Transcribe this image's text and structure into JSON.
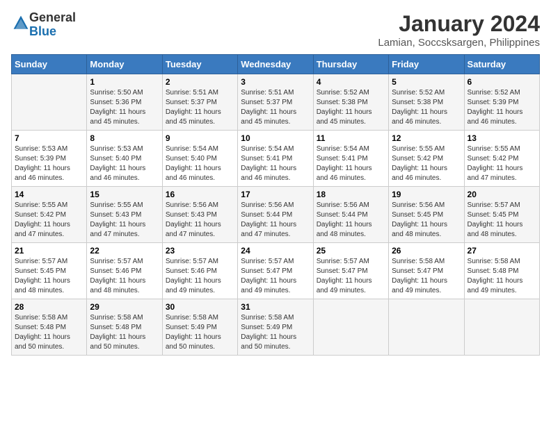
{
  "logo": {
    "general": "General",
    "blue": "Blue"
  },
  "title": {
    "month_year": "January 2024",
    "location": "Lamian, Soccsksargen, Philippines"
  },
  "days_of_week": [
    "Sunday",
    "Monday",
    "Tuesday",
    "Wednesday",
    "Thursday",
    "Friday",
    "Saturday"
  ],
  "weeks": [
    [
      {
        "day": "",
        "info": ""
      },
      {
        "day": "1",
        "info": "Sunrise: 5:50 AM\nSunset: 5:36 PM\nDaylight: 11 hours\nand 45 minutes."
      },
      {
        "day": "2",
        "info": "Sunrise: 5:51 AM\nSunset: 5:37 PM\nDaylight: 11 hours\nand 45 minutes."
      },
      {
        "day": "3",
        "info": "Sunrise: 5:51 AM\nSunset: 5:37 PM\nDaylight: 11 hours\nand 45 minutes."
      },
      {
        "day": "4",
        "info": "Sunrise: 5:52 AM\nSunset: 5:38 PM\nDaylight: 11 hours\nand 45 minutes."
      },
      {
        "day": "5",
        "info": "Sunrise: 5:52 AM\nSunset: 5:38 PM\nDaylight: 11 hours\nand 46 minutes."
      },
      {
        "day": "6",
        "info": "Sunrise: 5:52 AM\nSunset: 5:39 PM\nDaylight: 11 hours\nand 46 minutes."
      }
    ],
    [
      {
        "day": "7",
        "info": "Sunrise: 5:53 AM\nSunset: 5:39 PM\nDaylight: 11 hours\nand 46 minutes."
      },
      {
        "day": "8",
        "info": "Sunrise: 5:53 AM\nSunset: 5:40 PM\nDaylight: 11 hours\nand 46 minutes."
      },
      {
        "day": "9",
        "info": "Sunrise: 5:54 AM\nSunset: 5:40 PM\nDaylight: 11 hours\nand 46 minutes."
      },
      {
        "day": "10",
        "info": "Sunrise: 5:54 AM\nSunset: 5:41 PM\nDaylight: 11 hours\nand 46 minutes."
      },
      {
        "day": "11",
        "info": "Sunrise: 5:54 AM\nSunset: 5:41 PM\nDaylight: 11 hours\nand 46 minutes."
      },
      {
        "day": "12",
        "info": "Sunrise: 5:55 AM\nSunset: 5:42 PM\nDaylight: 11 hours\nand 46 minutes."
      },
      {
        "day": "13",
        "info": "Sunrise: 5:55 AM\nSunset: 5:42 PM\nDaylight: 11 hours\nand 47 minutes."
      }
    ],
    [
      {
        "day": "14",
        "info": "Sunrise: 5:55 AM\nSunset: 5:42 PM\nDaylight: 11 hours\nand 47 minutes."
      },
      {
        "day": "15",
        "info": "Sunrise: 5:55 AM\nSunset: 5:43 PM\nDaylight: 11 hours\nand 47 minutes."
      },
      {
        "day": "16",
        "info": "Sunrise: 5:56 AM\nSunset: 5:43 PM\nDaylight: 11 hours\nand 47 minutes."
      },
      {
        "day": "17",
        "info": "Sunrise: 5:56 AM\nSunset: 5:44 PM\nDaylight: 11 hours\nand 47 minutes."
      },
      {
        "day": "18",
        "info": "Sunrise: 5:56 AM\nSunset: 5:44 PM\nDaylight: 11 hours\nand 48 minutes."
      },
      {
        "day": "19",
        "info": "Sunrise: 5:56 AM\nSunset: 5:45 PM\nDaylight: 11 hours\nand 48 minutes."
      },
      {
        "day": "20",
        "info": "Sunrise: 5:57 AM\nSunset: 5:45 PM\nDaylight: 11 hours\nand 48 minutes."
      }
    ],
    [
      {
        "day": "21",
        "info": "Sunrise: 5:57 AM\nSunset: 5:45 PM\nDaylight: 11 hours\nand 48 minutes."
      },
      {
        "day": "22",
        "info": "Sunrise: 5:57 AM\nSunset: 5:46 PM\nDaylight: 11 hours\nand 48 minutes."
      },
      {
        "day": "23",
        "info": "Sunrise: 5:57 AM\nSunset: 5:46 PM\nDaylight: 11 hours\nand 49 minutes."
      },
      {
        "day": "24",
        "info": "Sunrise: 5:57 AM\nSunset: 5:47 PM\nDaylight: 11 hours\nand 49 minutes."
      },
      {
        "day": "25",
        "info": "Sunrise: 5:57 AM\nSunset: 5:47 PM\nDaylight: 11 hours\nand 49 minutes."
      },
      {
        "day": "26",
        "info": "Sunrise: 5:58 AM\nSunset: 5:47 PM\nDaylight: 11 hours\nand 49 minutes."
      },
      {
        "day": "27",
        "info": "Sunrise: 5:58 AM\nSunset: 5:48 PM\nDaylight: 11 hours\nand 49 minutes."
      }
    ],
    [
      {
        "day": "28",
        "info": "Sunrise: 5:58 AM\nSunset: 5:48 PM\nDaylight: 11 hours\nand 50 minutes."
      },
      {
        "day": "29",
        "info": "Sunrise: 5:58 AM\nSunset: 5:48 PM\nDaylight: 11 hours\nand 50 minutes."
      },
      {
        "day": "30",
        "info": "Sunrise: 5:58 AM\nSunset: 5:49 PM\nDaylight: 11 hours\nand 50 minutes."
      },
      {
        "day": "31",
        "info": "Sunrise: 5:58 AM\nSunset: 5:49 PM\nDaylight: 11 hours\nand 50 minutes."
      },
      {
        "day": "",
        "info": ""
      },
      {
        "day": "",
        "info": ""
      },
      {
        "day": "",
        "info": ""
      }
    ]
  ]
}
